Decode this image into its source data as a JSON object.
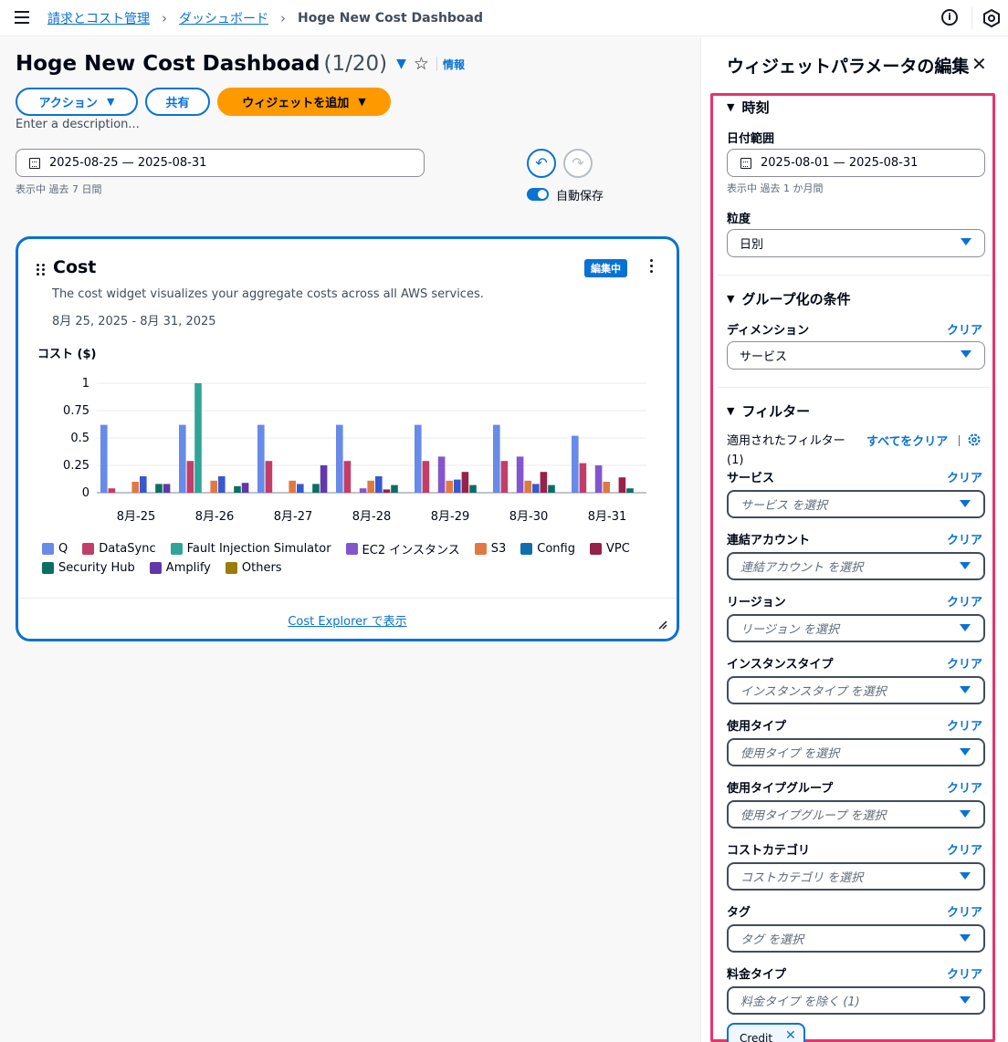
{
  "topbar": {
    "breadcrumb": [
      "請求とコスト管理",
      "ダッシュボード"
    ],
    "current": "Hoge New Cost Dashboad",
    "info_icon": "info-circle-icon",
    "settings_icon": "settings-hex-icon"
  },
  "header": {
    "title": "Hoge New Cost Dashboad",
    "count": "(1/20)",
    "info": "情報",
    "actions_label": "アクション",
    "share_label": "共有",
    "add_widget_label": "ウィジェットを追加",
    "description_placeholder": "Enter a description..."
  },
  "date_range": {
    "value": "2025-08-25 — 2025-08-31",
    "note": "表示中 過去 7 日間"
  },
  "autosave": {
    "label": "自動保存",
    "on": true
  },
  "widget": {
    "title": "Cost",
    "badge": "編集中",
    "description": "The cost widget visualizes your aggregate costs across all AWS services.",
    "range": "8月 25, 2025 - 8月 31, 2025",
    "y_title": "コスト ($)",
    "footer_link": "Cost Explorer で表示"
  },
  "chart_data": {
    "type": "bar",
    "categories": [
      "8月-25",
      "8月-26",
      "8月-27",
      "8月-28",
      "8月-29",
      "8月-30",
      "8月-31"
    ],
    "ylim": [
      0,
      1
    ],
    "yticks": [
      "0",
      "0.25",
      "0.5",
      "0.75",
      "1"
    ],
    "grid": true,
    "legend_position": "bottom",
    "series": [
      {
        "name": "Q",
        "color": "#688ae8",
        "values": [
          0.62,
          0.62,
          0.62,
          0.62,
          0.62,
          0.62,
          0.52
        ]
      },
      {
        "name": "DataSync",
        "color": "#c33d69",
        "values": [
          0.04,
          0.29,
          0.29,
          0.29,
          0.29,
          0.29,
          0.27
        ]
      },
      {
        "name": "Fault Injection Simulator",
        "color": "#2ea597",
        "values": [
          0,
          1.0,
          0,
          0,
          0,
          0,
          0
        ]
      },
      {
        "name": "EC2 インスタンス",
        "color": "#8456ce",
        "values": [
          0,
          0,
          0,
          0.04,
          0.33,
          0.33,
          0.25
        ]
      },
      {
        "name": "S3",
        "color": "#e07941",
        "values": [
          0.1,
          0.11,
          0.11,
          0.11,
          0.11,
          0.11,
          0.1
        ]
      },
      {
        "name": "Config",
        "color": "#3759ce",
        "values": [
          0.15,
          0.15,
          0.08,
          0.15,
          0.12,
          0.08,
          0
        ]
      },
      {
        "name": "VPC",
        "color": "#962249",
        "values": [
          0,
          0,
          0,
          0.03,
          0.19,
          0.19,
          0.14
        ]
      },
      {
        "name": "Security Hub",
        "color": "#096f64",
        "values": [
          0.08,
          0.06,
          0.08,
          0.07,
          0.07,
          0.07,
          0.04
        ]
      },
      {
        "name": "Amplify",
        "color": "#6237a7",
        "values": [
          0.08,
          0.09,
          0.25,
          0,
          0,
          0,
          0
        ]
      },
      {
        "name": "Others",
        "color": "#a84401",
        "values": [
          0,
          0,
          0,
          0,
          0,
          0,
          0
        ]
      }
    ]
  },
  "legend_colors": {
    "Q": "#688ae8",
    "DataSync": "#c33d69",
    "Fault Injection Simulator": "#2ea597",
    "EC2 インスタンス": "#8456ce",
    "S3": "#e07941",
    "Config": "#0f6fae",
    "VPC": "#962249",
    "Security Hub": "#096f64",
    "Amplify": "#6237a7",
    "Others": "#9a7b0b"
  },
  "panel": {
    "title": "ウィジェットパラメータの編集",
    "time_section": "時刻",
    "date_label": "日付範囲",
    "date_value": "2025-08-01 — 2025-08-31",
    "date_note": "表示中 過去 1 か月間",
    "granularity_label": "粒度",
    "granularity_value": "日別",
    "group_section": "グループ化の条件",
    "dimension_label": "ディメンション",
    "dimension_value": "サービス",
    "clear": "クリア",
    "filter_section": "フィルター",
    "applied_filters": "適用されたフィルター (1)",
    "clear_all": "すべてをクリア",
    "filters": [
      {
        "label": "サービス",
        "placeholder": "サービス を選択"
      },
      {
        "label": "連結アカウント",
        "placeholder": "連結アカウント を選択"
      },
      {
        "label": "リージョン",
        "placeholder": "リージョン を選択"
      },
      {
        "label": "インスタンスタイプ",
        "placeholder": "インスタンスタイプ を選択"
      },
      {
        "label": "使用タイプ",
        "placeholder": "使用タイプ を選択"
      },
      {
        "label": "使用タイプグループ",
        "placeholder": "使用タイプグループ を選択"
      },
      {
        "label": "コストカテゴリ",
        "placeholder": "コストカテゴリ を選択"
      },
      {
        "label": "タグ",
        "placeholder": "タグ を選択"
      },
      {
        "label": "料金タイプ",
        "placeholder": "料金タイプ を除く (1)"
      }
    ],
    "token": "Credit"
  }
}
